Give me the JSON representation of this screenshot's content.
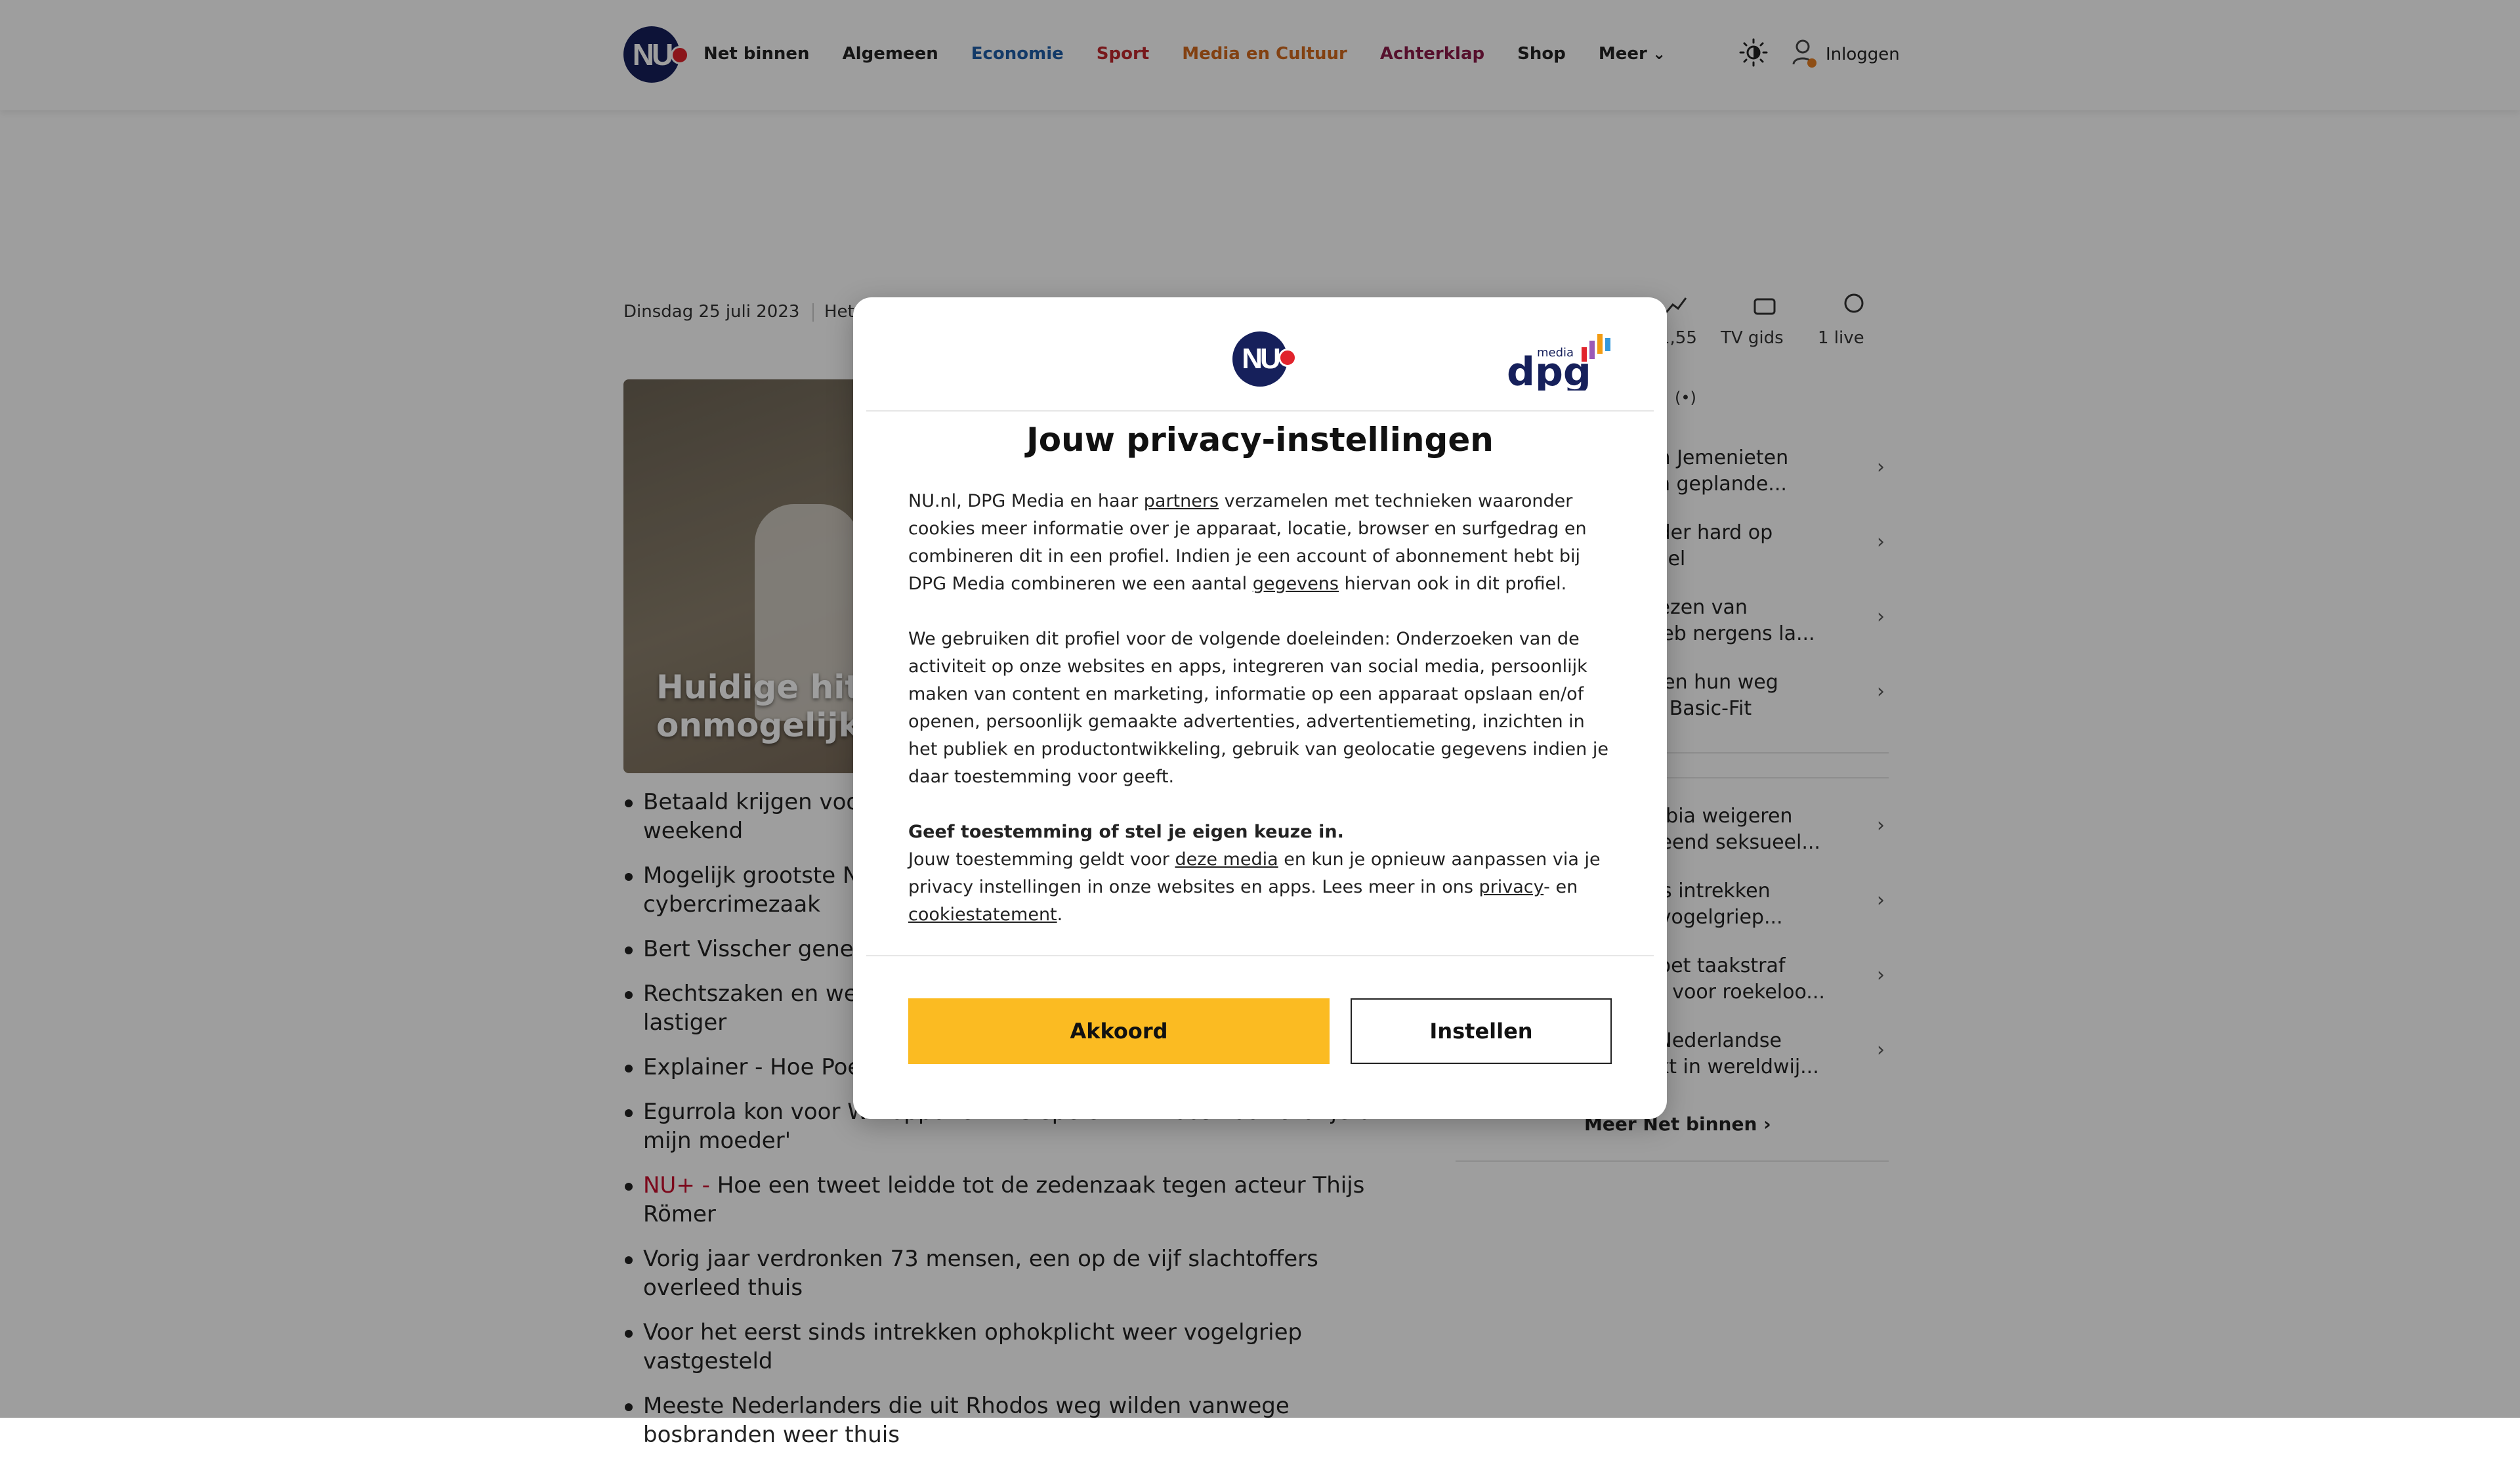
{
  "header": {
    "logo_text": "NU",
    "nav": [
      {
        "label": "Net binnen",
        "color": "#222222"
      },
      {
        "label": "Algemeen",
        "color": "#222222"
      },
      {
        "label": "Economie",
        "color": "#1f5ea8"
      },
      {
        "label": "Sport",
        "color": "#c0272d"
      },
      {
        "label": "Media en Cultuur",
        "color": "#d2691e"
      },
      {
        "label": "Achterklap",
        "color": "#8b1a4a"
      },
      {
        "label": "Shop",
        "color": "#222222"
      },
      {
        "label": "Meer",
        "color": "#222222"
      }
    ],
    "login_label": "Inloggen",
    "icons": [
      "nu-logo-icon",
      "theme-toggle-icon",
      "user-icon",
      "chevron-down-icon"
    ]
  },
  "subheader": {
    "date": "Dinsdag 25 juli 2023",
    "partial": "Het",
    "quick_links": [
      {
        "label": "1,55",
        "icon": "chart-icon"
      },
      {
        "label": "TV gids",
        "icon": "tv-icon"
      },
      {
        "label": "1 live",
        "icon": "football-icon"
      }
    ]
  },
  "hero": {
    "title": "Huidige hit\nonmogelijk"
  },
  "news_list": [
    {
      "text": "Betaald krijgen voor\nweekend"
    },
    {
      "text": "Mogelijk grootste Ne\ncybercrimezaak"
    },
    {
      "text": "Bert Visscher genez"
    },
    {
      "text": "Rechtszaken en weig\nlastiger"
    },
    {
      "text": "Explainer - Hoe Poet"
    },
    {
      "text": "Egurrola kon voor WK-opponent VS spelen: 'Ik koos voor Oranje om mijn moeder'"
    },
    {
      "prefix": "NU+",
      "text": "Hoe een tweet leidde tot de zedenzaak tegen acteur Thijs Römer"
    },
    {
      "text": "Vorig jaar verdronken 73 mensen, een op de vijf slachtoffers overleed thuis"
    },
    {
      "text": "Voor het eerst sinds intrekken ophokplicht weer vogelgriep vastgesteld"
    },
    {
      "text": "Meeste Nederlanders die uit Rhodos weg wilden vanwege bosbranden weer thuis"
    }
  ],
  "sidebar": {
    "group1": [
      "nden Jemenieten\negen geplande...",
      "minder hard op\nsoneel",
      "genezen van\nr: 'Heb nergens la...",
      "vinden hun weg\nolen Basic-Fit"
    ],
    "group2": [
      "Zambia weigeren\nermeend seksueel...",
      "sinds intrekken\neer vogelgriep...",
      "n moet taakstraf\nstraf voor roekeloo...",
      "ste Nederlandse\nepakt in wereldwij..."
    ],
    "more_label": "Meer Net binnen"
  },
  "modal": {
    "title": "Jouw privacy-instellingen",
    "dpg_media_label": "media",
    "dpg_label": "dpg",
    "p1_a": "NU.nl, DPG Media en haar ",
    "p1_link1": "partners",
    "p1_b": " verzamelen met technieken waaronder cookies meer informatie over je apparaat, locatie, browser en surfgedrag en combineren dit in een profiel. Indien je een account of abonnement hebt bij DPG Media combineren we een aantal ",
    "p1_link2": "gegevens",
    "p1_c": " hiervan ook in dit profiel.",
    "p2": "We gebruiken dit profiel voor de volgende doeleinden: Onderzoeken van de activiteit op onze websites en apps, integreren van social media, persoonlijk maken van content en marketing, informatie op een apparaat opslaan en/of openen, persoonlijk gemaakte advertenties, advertentiemeting, inzichten in het publiek en productontwikkeling, gebruik van geolocatie gegevens indien je daar toestemming voor geeft.",
    "p3_bold": "Geef toestemming of stel je eigen keuze in.",
    "p3_a": "Jouw toestemming geldt voor ",
    "p3_link1": "deze media",
    "p3_b": " en kun je opnieuw aanpassen via je privacy instellingen in onze websites en apps. Lees meer in ons ",
    "p3_link2": "privacy",
    "p3_c": "- en ",
    "p3_link3": "cookiestatement",
    "p3_d": ".",
    "accept_label": "Akkoord",
    "settings_label": "Instellen",
    "accent_color": "#fbbb22"
  }
}
